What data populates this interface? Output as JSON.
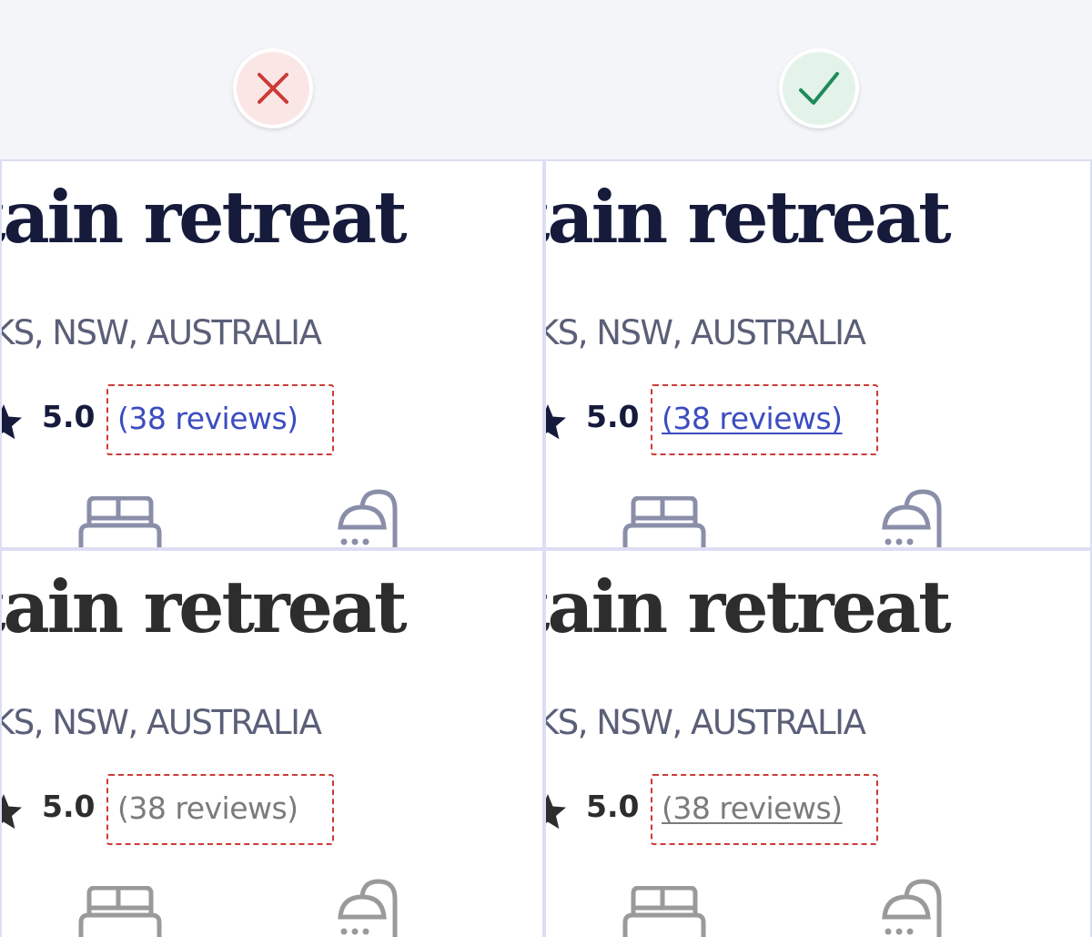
{
  "comparison": {
    "incorrect_badge": {
      "icon": "close-icon",
      "color": "#cc3b36"
    },
    "correct_badge": {
      "icon": "checkmark-icon",
      "color": "#1f8a5a"
    }
  },
  "cards": [
    {
      "title": "tain retreat",
      "location": "KS, NSW, AUSTRALIA",
      "rating": "5.0",
      "reviews_link": "(38 reviews)",
      "link_underlined": false,
      "theme": "blue"
    },
    {
      "title": "tain retreat",
      "location": "KS, NSW, AUSTRALIA",
      "rating": "5.0",
      "reviews_link": "(38 reviews)",
      "link_underlined": true,
      "theme": "blue"
    },
    {
      "title": "tain retreat",
      "location": "KS, NSW, AUSTRALIA",
      "rating": "5.0",
      "reviews_link": "(38 reviews)",
      "link_underlined": false,
      "theme": "grey"
    },
    {
      "title": "tain retreat",
      "location": "KS, NSW, AUSTRALIA",
      "rating": "5.0",
      "reviews_link": "(38 reviews)",
      "link_underlined": true,
      "theme": "grey"
    }
  ],
  "colors": {
    "link_blue": "#3c4dbf",
    "link_grey": "#7b7b7b",
    "highlight_border": "#cc3b36",
    "icon_blue": "#8a8ea8",
    "icon_grey": "#9a9a9a"
  }
}
